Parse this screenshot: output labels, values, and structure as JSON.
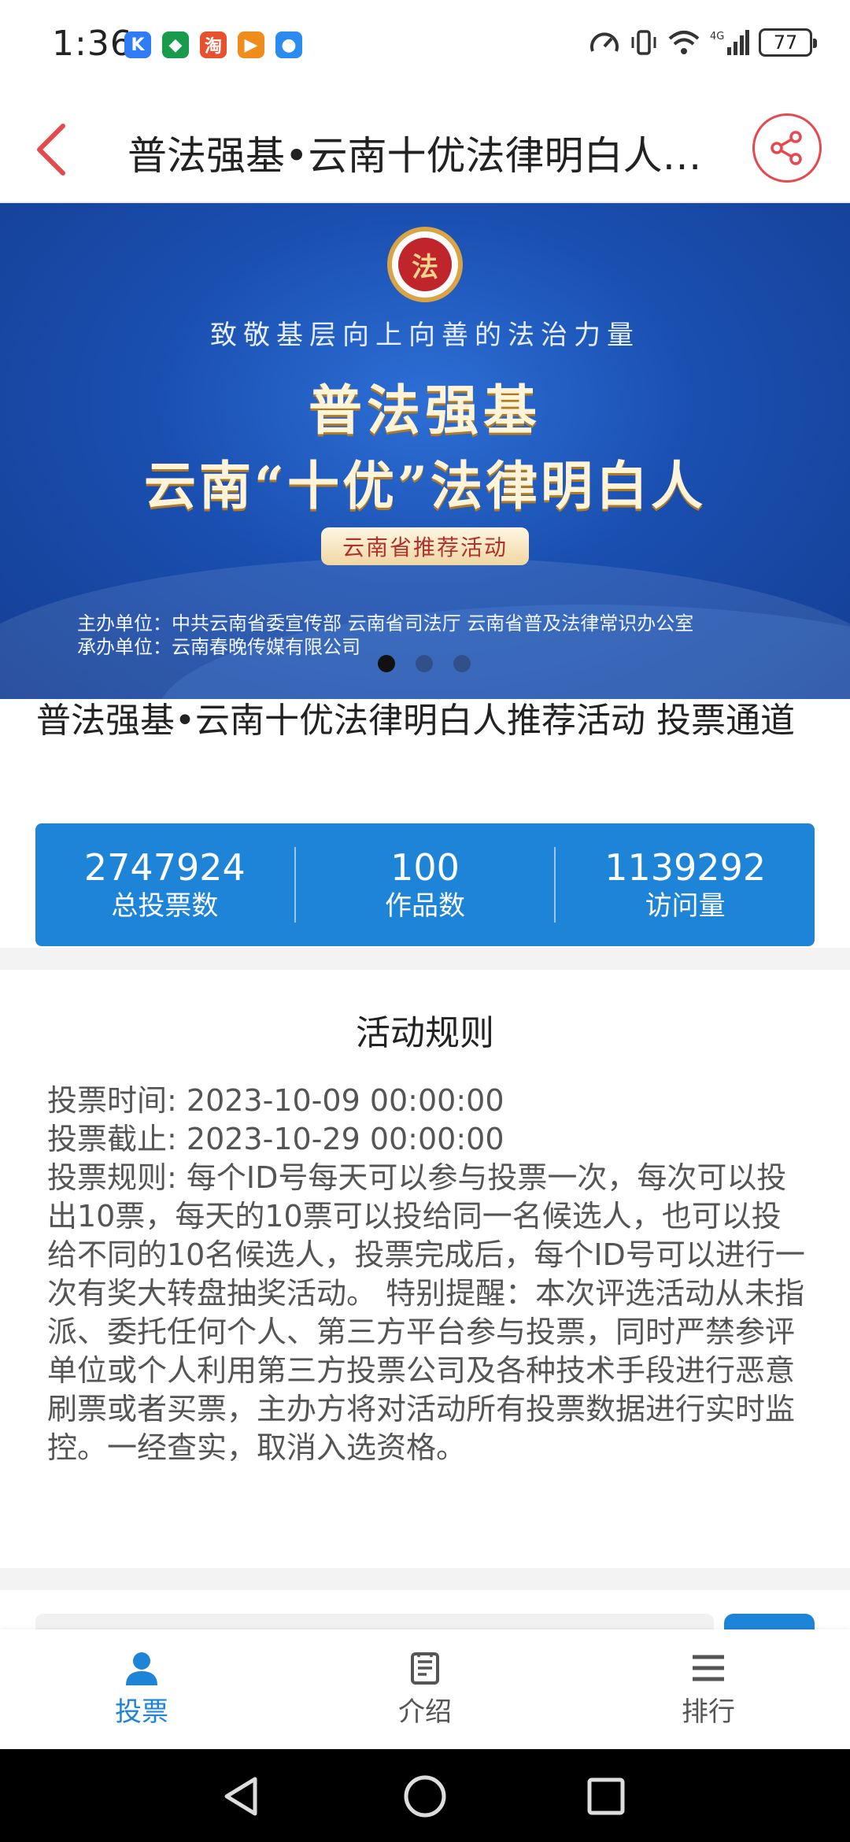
{
  "status_bar": {
    "time": "1:36",
    "network": "4G",
    "battery": "77",
    "apps": [
      {
        "icon": "kuaishou-app-icon",
        "glyph": "K",
        "color": "#2f7cf6"
      },
      {
        "icon": "game-app-icon",
        "glyph": "◆",
        "color": "#1a9b4b"
      },
      {
        "icon": "taobao-app-icon",
        "glyph": "淘",
        "color": "#e8502e"
      },
      {
        "icon": "video-app-icon",
        "glyph": "▶",
        "color": "#f08c1c"
      },
      {
        "icon": "bulb-app-icon",
        "glyph": "●",
        "color": "#2a8cf0"
      }
    ]
  },
  "header": {
    "title": "普法强基•云南十优法律明白人推荐活动 投票通道",
    "accent_color": "#e5484d"
  },
  "banner": {
    "emblem_text": "法",
    "subtitle": "致敬基层向上向善的法治力量",
    "main_line1": "普法强基",
    "main_line2": "云南“十优”法律明白人",
    "pill": "云南省推荐活动",
    "host": "主办单位：中共云南省委宣传部    云南省司法厅    云南省普及法律常识办公室",
    "organizer": "承办单位：云南春晚传媒有限公司"
  },
  "activity_title": "普法强基•云南十优法律明白人推荐活动 投票通道",
  "stats": [
    {
      "value": "2747924",
      "label": "总投票数"
    },
    {
      "value": "100",
      "label": "作品数"
    },
    {
      "value": "1139292",
      "label": "访问量"
    }
  ],
  "rules": {
    "heading": "活动规则",
    "start_label": "投票时间:",
    "start_value": "2023-10-09 00:00:00",
    "end_label": "投票截止:",
    "end_value": "2023-10-29 00:00:00",
    "rule_label": "投票规则:",
    "rule_text": "每个ID号每天可以参与投票一次，每次可以投出10票，每天的10票可以投给同一名候选人，也可以投给不同的10名候选人，投票完成后，每个ID号可以进行一次有奖大转盘抽奖活动。 特别提醒：本次评选活动从未指派、委托任何个人、第三方平台参与投票，同时严禁参评单位或个人利用第三方投票公司及各种技术手段进行恶意刷票或者买票，主办方将对活动所有投票数据进行实时监控。一经查实，取消入选资格。"
  },
  "tabs": [
    {
      "label": "投票",
      "icon": "person-icon",
      "active": true
    },
    {
      "label": "介绍",
      "icon": "document-icon",
      "active": false
    },
    {
      "label": "排行",
      "icon": "menu-icon",
      "active": false
    }
  ],
  "colors": {
    "primary": "#1e84d8",
    "accent_red": "#e5484d"
  }
}
